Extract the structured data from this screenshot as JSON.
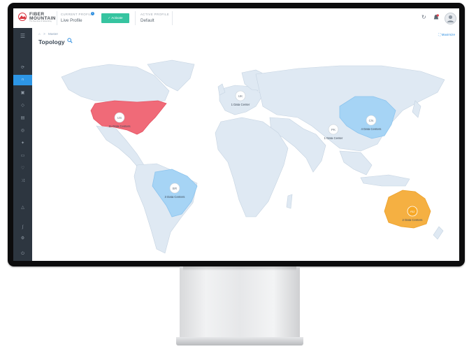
{
  "header": {
    "current_profile_label": "CURRENT PROFILE",
    "current_profile_value": "Live Profile",
    "activate_label": "✓ Activate",
    "active_profile_label": "ACTIVE PROFILE",
    "active_profile_value": "Default",
    "info_badge": "i"
  },
  "logo": {
    "brand": "FIBER MOUNTAIN",
    "tagline": "The New Era of Networking"
  },
  "breadcrumb": {
    "home_icon": "home-icon",
    "separator": ">",
    "item": "Master"
  },
  "page": {
    "title": "Topology",
    "maximize_label": "⛶ Maximize"
  },
  "icons": {
    "refresh": "refresh-icon",
    "notification": "notification-icon",
    "user": "user-avatar-icon",
    "menu": "hamburger-menu-icon",
    "search": "search-icon"
  },
  "colors": {
    "sidebar": "#2d3640",
    "sidebar_active": "#2d96e6",
    "land": "#dfe9f3",
    "us_region": "#f06a78",
    "cn_region": "#a6d4f5",
    "br_region": "#a6d4f5",
    "au_region": "#f5b042",
    "activate": "#36c4a0"
  },
  "locations": [
    {
      "code": "US",
      "label": "11 Data Centers"
    },
    {
      "code": "UK",
      "label": "1 Data Center"
    },
    {
      "code": "PK",
      "label": "1 Data Center"
    },
    {
      "code": "CN",
      "label": "4 Data Centers"
    },
    {
      "code": "BR",
      "label": "3 Data Centers"
    },
    {
      "code": "AU",
      "label": "2 Data Centers"
    }
  ]
}
